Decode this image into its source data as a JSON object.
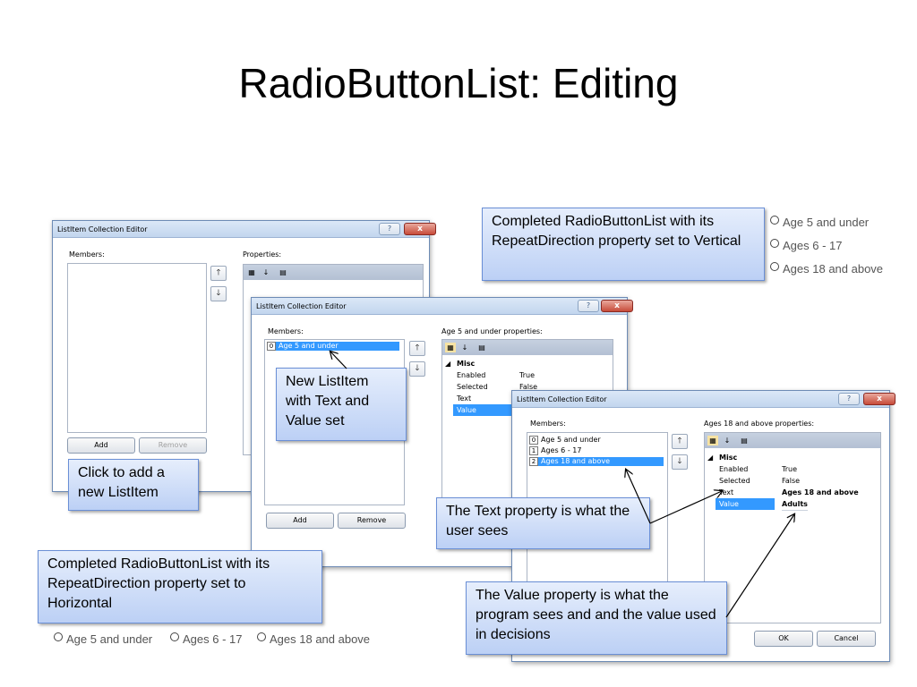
{
  "slide": {
    "title": "RadioButtonList: Editing"
  },
  "dialog_empty": {
    "title": "ListItem Collection Editor",
    "help": "?",
    "close": "x",
    "members_label": "Members:",
    "properties_label": "Properties:",
    "add": "Add",
    "remove": "Remove"
  },
  "dialog_one": {
    "title": "ListItem Collection Editor",
    "help": "?",
    "close": "x",
    "members_label": "Members:",
    "properties_label": "Age 5 and under properties:",
    "items": [
      {
        "index": "0",
        "label": "Age 5 and under"
      }
    ],
    "category": "Misc",
    "properties": [
      {
        "name": "Enabled",
        "value": "True"
      },
      {
        "name": "Selected",
        "value": "False"
      },
      {
        "name": "Text",
        "value": ""
      },
      {
        "name": "Value",
        "value": ""
      }
    ],
    "add": "Add",
    "remove": "Remove"
  },
  "dialog_three": {
    "title": "ListItem Collection Editor",
    "help": "?",
    "close": "x",
    "members_label": "Members:",
    "properties_label": "Ages 18 and above properties:",
    "items": [
      {
        "index": "0",
        "label": "Age 5 and under"
      },
      {
        "index": "1",
        "label": "Ages 6 - 17"
      },
      {
        "index": "2",
        "label": "Ages 18 and above"
      }
    ],
    "category": "Misc",
    "properties": [
      {
        "name": "Enabled",
        "value": "True"
      },
      {
        "name": "Selected",
        "value": "False"
      },
      {
        "name": "Text",
        "value": "Ages 18 and above"
      },
      {
        "name": "Value",
        "value": "Adults"
      }
    ],
    "ok": "OK",
    "cancel": "Cancel"
  },
  "callouts": {
    "vertical": "Completed RadioButtonList with its RepeatDirection property set to Vertical",
    "new_item": "New ListItem with Text and Value set",
    "click_add": "Click to add a new ListItem",
    "text_prop": "The Text property is what the user sees",
    "horizontal": "Completed RadioButtonList with its RepeatDirection property set to Horizontal",
    "value_prop": "The Value property is what the program sees and and the value used in decisions"
  },
  "radio_vertical": [
    "Age 5 and under",
    "Ages 6 - 17",
    "Ages 18 and above"
  ],
  "radio_horizontal": [
    "Age 5 and under",
    "Ages 6 - 17",
    "Ages 18 and above"
  ],
  "colors": {
    "selection": "#3399ff",
    "callout_border": "#6a8fd6",
    "title_bar": "#c2d6ee"
  }
}
